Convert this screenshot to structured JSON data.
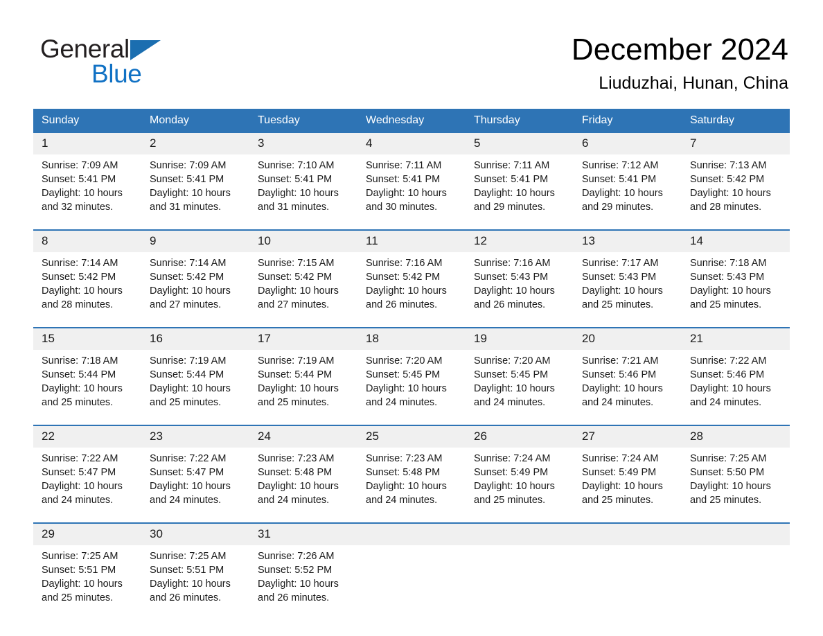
{
  "brand": {
    "name_part1": "General",
    "name_part2": "Blue",
    "logo_icon": "triangle-logo-icon",
    "colors": {
      "blue": "#1071c4",
      "dark": "#231f20"
    }
  },
  "header": {
    "month_title": "December 2024",
    "location": "Liuduzhai, Hunan, China"
  },
  "calendar": {
    "accent_color": "#2e74b5",
    "daynum_background": "#f0f0f0",
    "weekday_headers": [
      "Sunday",
      "Monday",
      "Tuesday",
      "Wednesday",
      "Thursday",
      "Friday",
      "Saturday"
    ],
    "weeks": [
      [
        {
          "day": "1",
          "sunrise": "Sunrise: 7:09 AM",
          "sunset": "Sunset: 5:41 PM",
          "daylight": "Daylight: 10 hours and 32 minutes."
        },
        {
          "day": "2",
          "sunrise": "Sunrise: 7:09 AM",
          "sunset": "Sunset: 5:41 PM",
          "daylight": "Daylight: 10 hours and 31 minutes."
        },
        {
          "day": "3",
          "sunrise": "Sunrise: 7:10 AM",
          "sunset": "Sunset: 5:41 PM",
          "daylight": "Daylight: 10 hours and 31 minutes."
        },
        {
          "day": "4",
          "sunrise": "Sunrise: 7:11 AM",
          "sunset": "Sunset: 5:41 PM",
          "daylight": "Daylight: 10 hours and 30 minutes."
        },
        {
          "day": "5",
          "sunrise": "Sunrise: 7:11 AM",
          "sunset": "Sunset: 5:41 PM",
          "daylight": "Daylight: 10 hours and 29 minutes."
        },
        {
          "day": "6",
          "sunrise": "Sunrise: 7:12 AM",
          "sunset": "Sunset: 5:41 PM",
          "daylight": "Daylight: 10 hours and 29 minutes."
        },
        {
          "day": "7",
          "sunrise": "Sunrise: 7:13 AM",
          "sunset": "Sunset: 5:42 PM",
          "daylight": "Daylight: 10 hours and 28 minutes."
        }
      ],
      [
        {
          "day": "8",
          "sunrise": "Sunrise: 7:14 AM",
          "sunset": "Sunset: 5:42 PM",
          "daylight": "Daylight: 10 hours and 28 minutes."
        },
        {
          "day": "9",
          "sunrise": "Sunrise: 7:14 AM",
          "sunset": "Sunset: 5:42 PM",
          "daylight": "Daylight: 10 hours and 27 minutes."
        },
        {
          "day": "10",
          "sunrise": "Sunrise: 7:15 AM",
          "sunset": "Sunset: 5:42 PM",
          "daylight": "Daylight: 10 hours and 27 minutes."
        },
        {
          "day": "11",
          "sunrise": "Sunrise: 7:16 AM",
          "sunset": "Sunset: 5:42 PM",
          "daylight": "Daylight: 10 hours and 26 minutes."
        },
        {
          "day": "12",
          "sunrise": "Sunrise: 7:16 AM",
          "sunset": "Sunset: 5:43 PM",
          "daylight": "Daylight: 10 hours and 26 minutes."
        },
        {
          "day": "13",
          "sunrise": "Sunrise: 7:17 AM",
          "sunset": "Sunset: 5:43 PM",
          "daylight": "Daylight: 10 hours and 25 minutes."
        },
        {
          "day": "14",
          "sunrise": "Sunrise: 7:18 AM",
          "sunset": "Sunset: 5:43 PM",
          "daylight": "Daylight: 10 hours and 25 minutes."
        }
      ],
      [
        {
          "day": "15",
          "sunrise": "Sunrise: 7:18 AM",
          "sunset": "Sunset: 5:44 PM",
          "daylight": "Daylight: 10 hours and 25 minutes."
        },
        {
          "day": "16",
          "sunrise": "Sunrise: 7:19 AM",
          "sunset": "Sunset: 5:44 PM",
          "daylight": "Daylight: 10 hours and 25 minutes."
        },
        {
          "day": "17",
          "sunrise": "Sunrise: 7:19 AM",
          "sunset": "Sunset: 5:44 PM",
          "daylight": "Daylight: 10 hours and 25 minutes."
        },
        {
          "day": "18",
          "sunrise": "Sunrise: 7:20 AM",
          "sunset": "Sunset: 5:45 PM",
          "daylight": "Daylight: 10 hours and 24 minutes."
        },
        {
          "day": "19",
          "sunrise": "Sunrise: 7:20 AM",
          "sunset": "Sunset: 5:45 PM",
          "daylight": "Daylight: 10 hours and 24 minutes."
        },
        {
          "day": "20",
          "sunrise": "Sunrise: 7:21 AM",
          "sunset": "Sunset: 5:46 PM",
          "daylight": "Daylight: 10 hours and 24 minutes."
        },
        {
          "day": "21",
          "sunrise": "Sunrise: 7:22 AM",
          "sunset": "Sunset: 5:46 PM",
          "daylight": "Daylight: 10 hours and 24 minutes."
        }
      ],
      [
        {
          "day": "22",
          "sunrise": "Sunrise: 7:22 AM",
          "sunset": "Sunset: 5:47 PM",
          "daylight": "Daylight: 10 hours and 24 minutes."
        },
        {
          "day": "23",
          "sunrise": "Sunrise: 7:22 AM",
          "sunset": "Sunset: 5:47 PM",
          "daylight": "Daylight: 10 hours and 24 minutes."
        },
        {
          "day": "24",
          "sunrise": "Sunrise: 7:23 AM",
          "sunset": "Sunset: 5:48 PM",
          "daylight": "Daylight: 10 hours and 24 minutes."
        },
        {
          "day": "25",
          "sunrise": "Sunrise: 7:23 AM",
          "sunset": "Sunset: 5:48 PM",
          "daylight": "Daylight: 10 hours and 24 minutes."
        },
        {
          "day": "26",
          "sunrise": "Sunrise: 7:24 AM",
          "sunset": "Sunset: 5:49 PM",
          "daylight": "Daylight: 10 hours and 25 minutes."
        },
        {
          "day": "27",
          "sunrise": "Sunrise: 7:24 AM",
          "sunset": "Sunset: 5:49 PM",
          "daylight": "Daylight: 10 hours and 25 minutes."
        },
        {
          "day": "28",
          "sunrise": "Sunrise: 7:25 AM",
          "sunset": "Sunset: 5:50 PM",
          "daylight": "Daylight: 10 hours and 25 minutes."
        }
      ],
      [
        {
          "day": "29",
          "sunrise": "Sunrise: 7:25 AM",
          "sunset": "Sunset: 5:51 PM",
          "daylight": "Daylight: 10 hours and 25 minutes."
        },
        {
          "day": "30",
          "sunrise": "Sunrise: 7:25 AM",
          "sunset": "Sunset: 5:51 PM",
          "daylight": "Daylight: 10 hours and 26 minutes."
        },
        {
          "day": "31",
          "sunrise": "Sunrise: 7:26 AM",
          "sunset": "Sunset: 5:52 PM",
          "daylight": "Daylight: 10 hours and 26 minutes."
        },
        {
          "day": "",
          "sunrise": "",
          "sunset": "",
          "daylight": ""
        },
        {
          "day": "",
          "sunrise": "",
          "sunset": "",
          "daylight": ""
        },
        {
          "day": "",
          "sunrise": "",
          "sunset": "",
          "daylight": ""
        },
        {
          "day": "",
          "sunrise": "",
          "sunset": "",
          "daylight": ""
        }
      ]
    ]
  }
}
